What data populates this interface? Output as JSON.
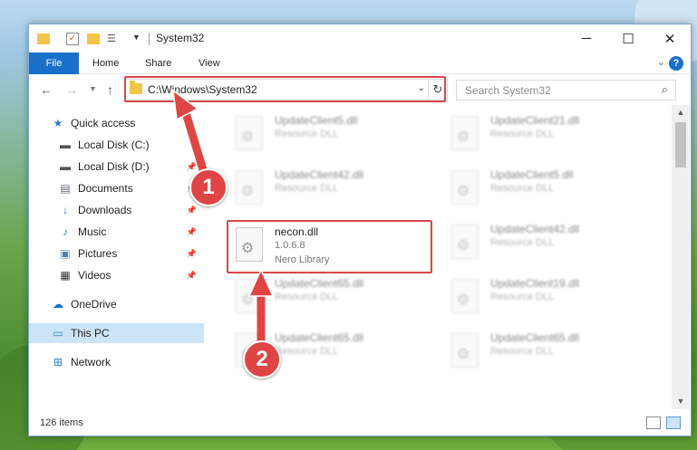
{
  "window": {
    "title": "System32"
  },
  "ribbon": {
    "tabs": [
      "File",
      "Home",
      "Share",
      "View"
    ],
    "help_label": "?"
  },
  "address": {
    "path": "C:\\Windows\\System32"
  },
  "search": {
    "placeholder": "Search System32"
  },
  "sidebar": {
    "items": [
      {
        "label": "Quick access",
        "icon": "star-icon"
      },
      {
        "label": "Local Disk (C:)",
        "icon": "drive-icon"
      },
      {
        "label": "Local Disk (D:)",
        "icon": "drive-icon",
        "pinned": true
      },
      {
        "label": "Documents",
        "icon": "documents-icon",
        "pinned": true
      },
      {
        "label": "Downloads",
        "icon": "download-icon",
        "pinned": true
      },
      {
        "label": "Music",
        "icon": "music-icon",
        "pinned": true
      },
      {
        "label": "Pictures",
        "icon": "pictures-icon",
        "pinned": true
      },
      {
        "label": "Videos",
        "icon": "videos-icon",
        "pinned": true
      },
      {
        "label": "OneDrive",
        "icon": "cloud-icon"
      },
      {
        "label": "This PC",
        "icon": "computer-icon",
        "selected": true
      },
      {
        "label": "Network",
        "icon": "network-icon"
      }
    ]
  },
  "files": {
    "left": [
      {
        "name": "UpdateClient5.dll",
        "desc": "Resource DLL"
      },
      {
        "name": "UpdateClient42.dll",
        "desc": "Resource DLL"
      },
      {
        "name": "necon.dll",
        "version": "1.0.6.8",
        "desc": "Nero Library"
      },
      {
        "name": "UpdateClient65.dll",
        "desc": "Resource DLL"
      },
      {
        "name": "UpdateClient65.dll",
        "desc": "Resource DLL"
      }
    ],
    "right": [
      {
        "name": "UpdateClient21.dll",
        "desc": "Resource DLL"
      },
      {
        "name": "UpdateClient5.dll",
        "desc": "Resource DLL"
      },
      {
        "name": "UpdateClient42.dll",
        "desc": "Resource DLL"
      },
      {
        "name": "UpdateClient19.dll",
        "desc": "Resource DLL"
      },
      {
        "name": "UpdateClient65.dll",
        "desc": "Resource DLL"
      }
    ]
  },
  "status": {
    "item_count": "126 items"
  },
  "annotations": {
    "step1": "1",
    "step2": "2",
    "color": "#e04545"
  },
  "colors": {
    "accent": "#1a6fc9",
    "selection": "#cce4f7",
    "highlight_border": "#d64848"
  }
}
